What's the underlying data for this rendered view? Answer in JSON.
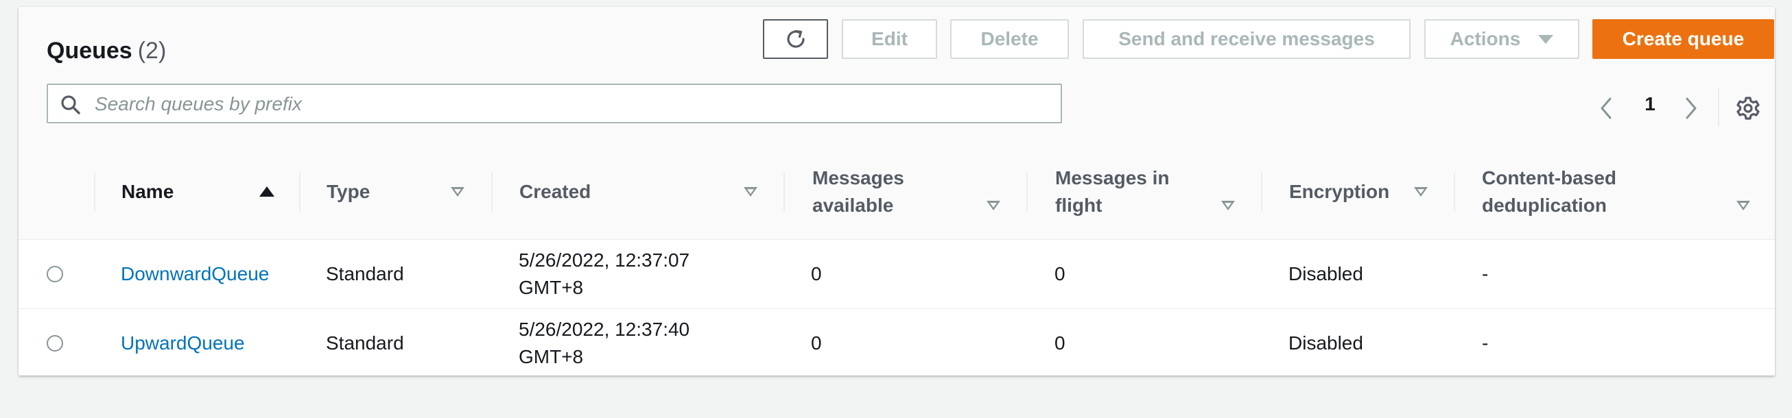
{
  "header": {
    "title": "Queues",
    "count": "(2)"
  },
  "toolbar": {
    "refresh_icon": "refresh-icon",
    "edit_label": "Edit",
    "delete_label": "Delete",
    "send_label": "Send and receive messages",
    "actions_label": "Actions",
    "create_label": "Create queue"
  },
  "colors": {
    "accent": "#ec7211",
    "link": "#0073bb",
    "disabled_text": "#aab7b8"
  },
  "search": {
    "placeholder": "Search queues by prefix",
    "value": ""
  },
  "pagination": {
    "current_page": "1"
  },
  "table": {
    "columns": [
      {
        "label": "Name",
        "sort": "ascending"
      },
      {
        "label": "Type",
        "sort": "sortable"
      },
      {
        "label": "Created",
        "sort": "sortable"
      },
      {
        "label": "Messages available",
        "sort": "sortable"
      },
      {
        "label": "Messages in flight",
        "sort": "sortable"
      },
      {
        "label": "Encryption",
        "sort": "sortable"
      },
      {
        "label": "Content-based deduplication",
        "sort": "sortable"
      }
    ],
    "rows": [
      {
        "name": "DownwardQueue",
        "type": "Standard",
        "created_date": "5/26/2022, 12:37:07",
        "created_tz": "GMT+8",
        "messages_available": "0",
        "messages_in_flight": "0",
        "encryption": "Disabled",
        "deduplication": "-"
      },
      {
        "name": "UpwardQueue",
        "type": "Standard",
        "created_date": "5/26/2022, 12:37:40",
        "created_tz": "GMT+8",
        "messages_available": "0",
        "messages_in_flight": "0",
        "encryption": "Disabled",
        "deduplication": "-"
      }
    ]
  }
}
